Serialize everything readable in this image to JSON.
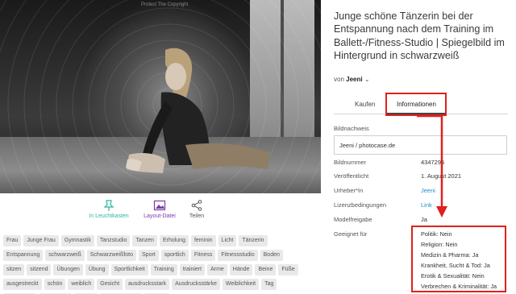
{
  "photo": {
    "watermark": "Protect The Copyright"
  },
  "actions": {
    "lightbox": "In Leuchtkasten",
    "layout": "Layout-Datei",
    "share": "Teilen"
  },
  "tags": [
    "Frau",
    "Junge Frau",
    "Gymnastik",
    "Tanzstudio",
    "Tanzen",
    "Erholung",
    "feminin",
    "Licht",
    "Tänzerin",
    "Entspannung",
    "schwarzweiß",
    "Schwarzweißfoto",
    "Sport",
    "sportlich",
    "Fitness",
    "Fitnessstudio",
    "Boden",
    "sitzen",
    "sitzend",
    "Übungen",
    "Übung",
    "Sportlichkeit",
    "Training",
    "trainiert",
    "Arme",
    "Hände",
    "Beine",
    "Füße",
    "ausgestreckt",
    "schön",
    "weiblich",
    "Gesicht",
    "ausdrucksstark",
    "Ausdrucksstärke",
    "Weiblichkeit",
    "Tag",
    "Rythmisch",
    "Bewegung",
    "Körper",
    "Körperhaltung",
    "Spiegel"
  ],
  "title": "Junge schöne Tänzerin bei der Entspannung nach dem Training im Ballett-/Fitness-Studio | Spiegelbild im Hintergrund in schwarzweiß",
  "byline": {
    "prefix": "von",
    "author": "Jeeni"
  },
  "tabs": {
    "buy": "Kaufen",
    "info": "Informationen"
  },
  "info": {
    "credit_label": "Bildnachweis",
    "credit_value": "Jeeni / photocase.de",
    "number_label": "Bildnummer",
    "number_value": "4347295",
    "published_label": "Veröffentlicht",
    "published_value": "1. August 2021",
    "author_label": "Urheber*In",
    "author_value": "Jeeni",
    "license_label": "Lizenzbedingungen",
    "license_value": "Link",
    "release_label": "Modelfreigabe",
    "release_value": "Ja",
    "suitable_label": "Geeignet für",
    "suitable": [
      "Politik: Nein",
      "Religion: Nein",
      "Medizin & Pharma: Ja",
      "Krankheit, Sucht & Tod: Ja",
      "Erotik & Sexualität: Nein",
      "Verbrechen & Kriminalität: Ja"
    ]
  },
  "colors": {
    "highlight_red": "#e0201e",
    "teal": "#2bb6a5",
    "purple": "#7a3aa8",
    "link_blue": "#1d8fc6"
  }
}
